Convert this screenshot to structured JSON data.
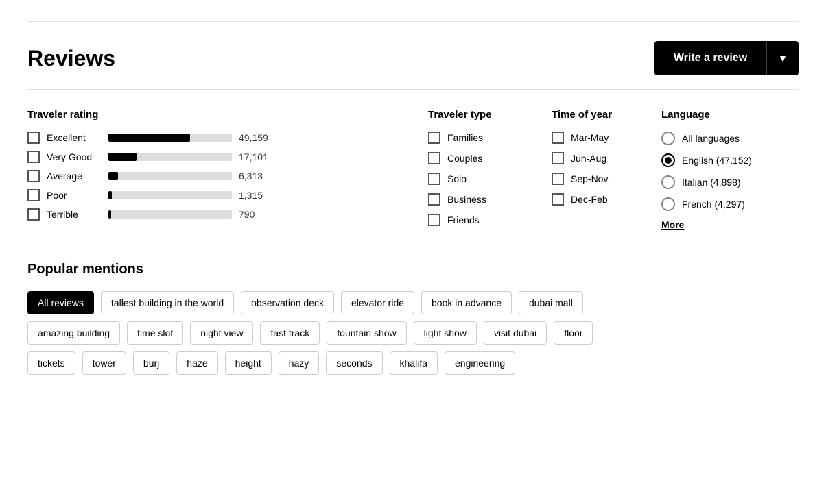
{
  "topbar": {},
  "header": {
    "title": "Reviews",
    "write_review_label": "Write a review"
  },
  "traveler_rating": {
    "title": "Traveler rating",
    "items": [
      {
        "label": "Excellent",
        "count": "49,159",
        "bar_pct": 66
      },
      {
        "label": "Very Good",
        "count": "17,101",
        "bar_pct": 23
      },
      {
        "label": "Average",
        "count": "6,313",
        "bar_pct": 8
      },
      {
        "label": "Poor",
        "count": "1,315",
        "bar_pct": 3
      },
      {
        "label": "Terrible",
        "count": "790",
        "bar_pct": 2
      }
    ]
  },
  "traveler_type": {
    "title": "Traveler type",
    "items": [
      "Families",
      "Couples",
      "Solo",
      "Business",
      "Friends"
    ]
  },
  "time_of_year": {
    "title": "Time of year",
    "items": [
      "Mar-May",
      "Jun-Aug",
      "Sep-Nov",
      "Dec-Feb"
    ]
  },
  "language": {
    "title": "Language",
    "items": [
      {
        "label": "All languages",
        "selected": false
      },
      {
        "label": "English (47,152)",
        "selected": true
      },
      {
        "label": "Italian (4,898)",
        "selected": false
      },
      {
        "label": "French (4,297)",
        "selected": false
      }
    ],
    "more_label": "More"
  },
  "popular_mentions": {
    "title": "Popular mentions",
    "rows": [
      [
        "All reviews",
        "tallest building in the world",
        "observation deck",
        "elevator ride",
        "book in advance",
        "dubai mall"
      ],
      [
        "amazing building",
        "time slot",
        "night view",
        "fast track",
        "fountain show",
        "light show",
        "visit dubai",
        "floor"
      ],
      [
        "tickets",
        "tower",
        "burj",
        "haze",
        "height",
        "hazy",
        "seconds",
        "khalifa",
        "engineering"
      ]
    ],
    "active": "All reviews"
  }
}
